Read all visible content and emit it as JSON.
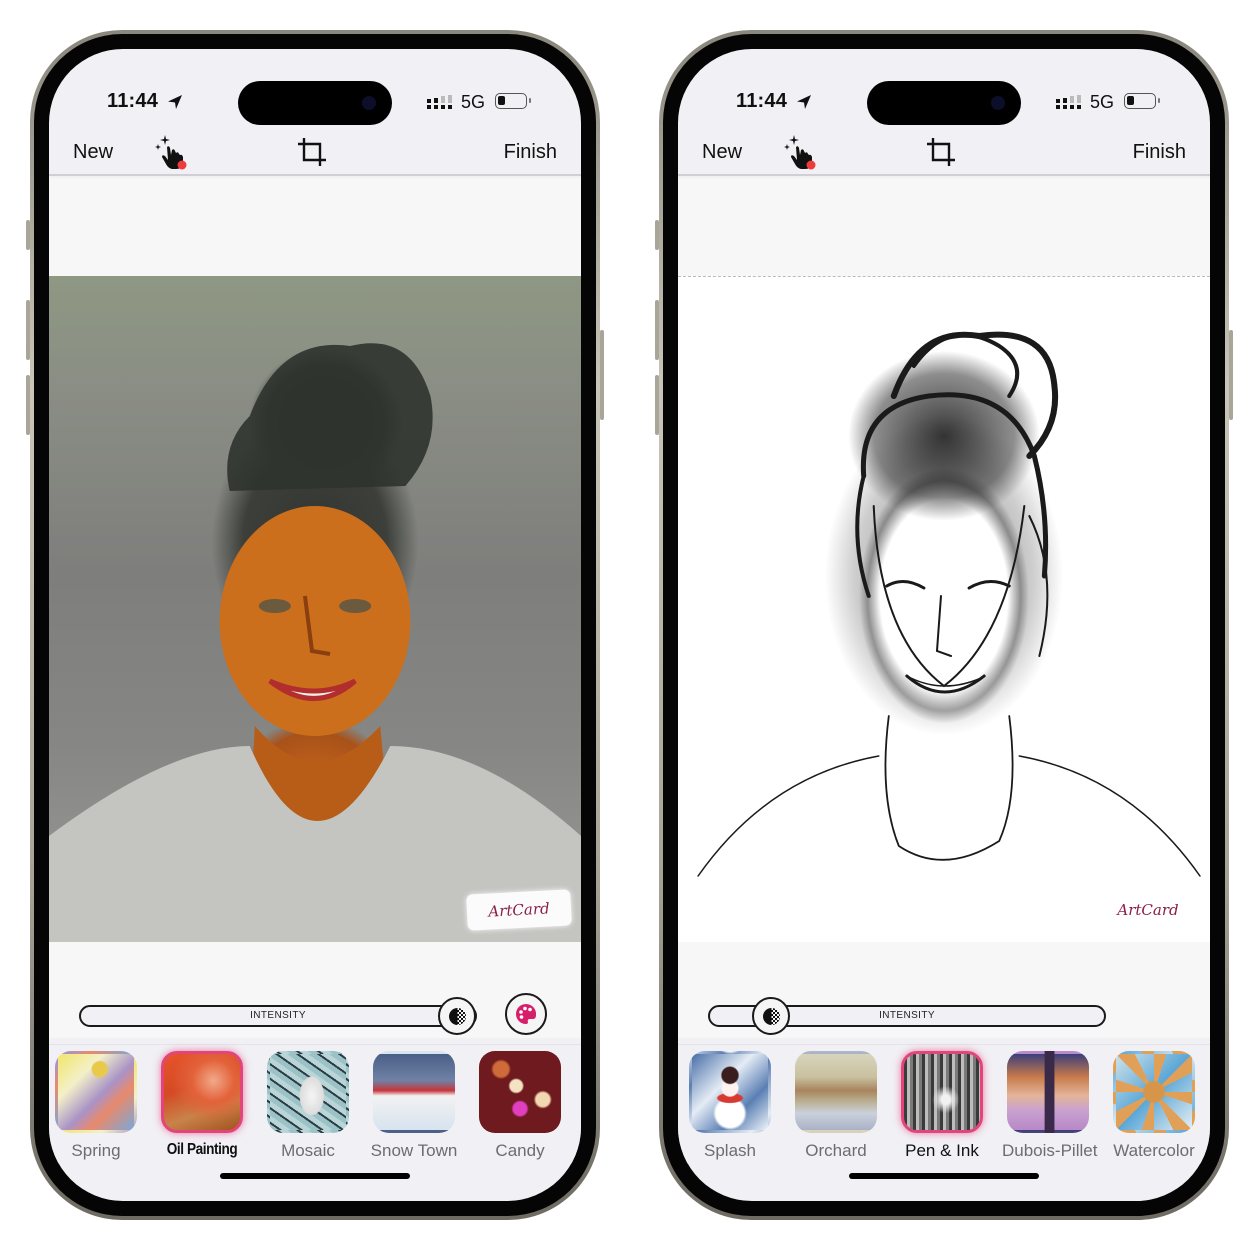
{
  "phones": [
    {
      "status": {
        "time": "11:44",
        "network": "5G"
      },
      "toolbar": {
        "new_label": "New",
        "finish_label": "Finish"
      },
      "watermark": "ArtCard",
      "slider": {
        "label": "INTENSITY",
        "value": 1.0
      },
      "filters": [
        {
          "label": "Spring",
          "selected": false
        },
        {
          "label": "Oil Painting",
          "selected": true
        },
        {
          "label": "Mosaic",
          "selected": false
        },
        {
          "label": "Snow Town",
          "selected": false
        },
        {
          "label": "Candy",
          "selected": false
        }
      ]
    },
    {
      "status": {
        "time": "11:44",
        "network": "5G"
      },
      "toolbar": {
        "new_label": "New",
        "finish_label": "Finish"
      },
      "watermark": "ArtCard",
      "slider": {
        "label": "INTENSITY",
        "value": 0.12
      },
      "filters": [
        {
          "label": "Splash",
          "selected": false
        },
        {
          "label": "Orchard",
          "selected": false
        },
        {
          "label": "Pen & Ink",
          "selected": true
        },
        {
          "label": "Dubois-Pillet",
          "selected": false
        },
        {
          "label": "Watercolor",
          "selected": false
        }
      ]
    }
  ],
  "colors": {
    "accent": "#e2457a",
    "notification_dot": "#ef3b3b",
    "watermark": "#8b1f4a"
  }
}
